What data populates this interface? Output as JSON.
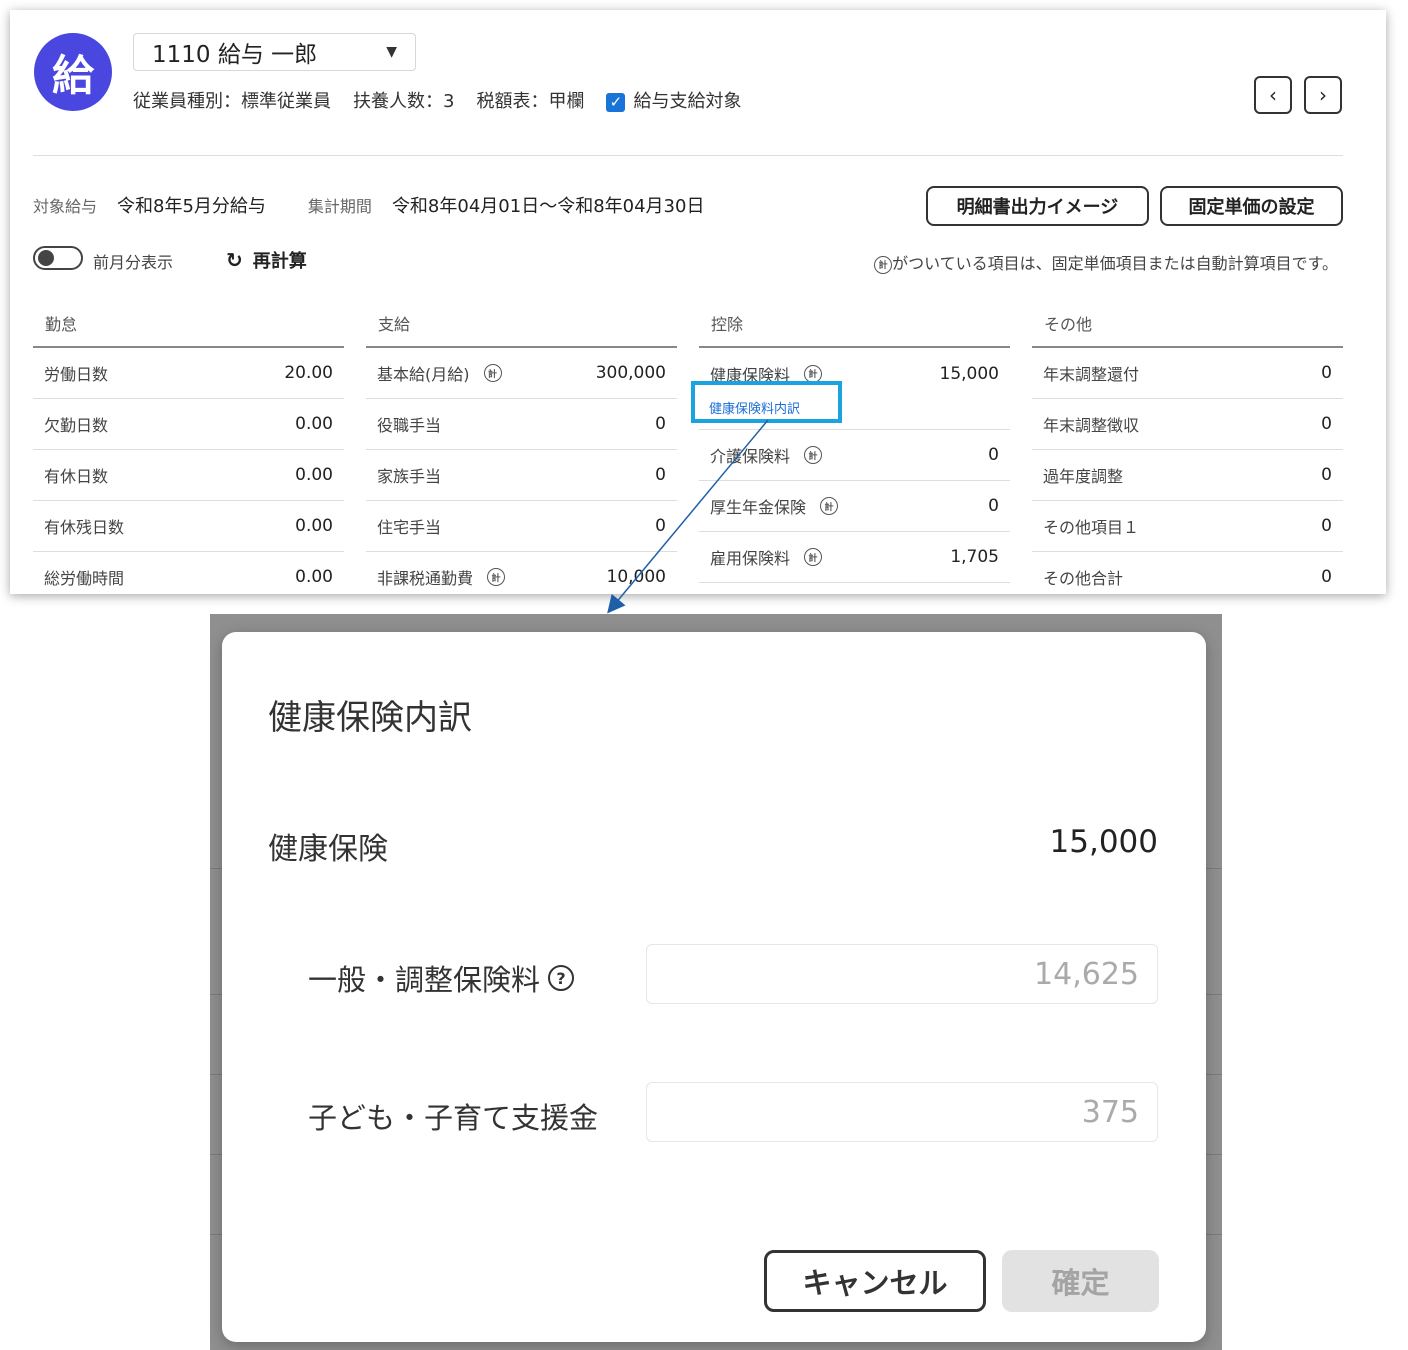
{
  "employee": {
    "avatar_char": "給",
    "selected": "1110 給与 一郎",
    "type": "従業員種別：標準従業員",
    "dependents": "扶養人数：3",
    "tax_table": "税額表：甲欄",
    "payroll_target_label": "給与支給対象",
    "payroll_target_checked": true
  },
  "period": {
    "target_label": "対象給与",
    "target_value": "令和8年5月分給与",
    "range_label": "集計期間",
    "range_value": "令和8年04月01日〜令和8年04月30日"
  },
  "actions": {
    "statement_preview": "明細書出力イメージ",
    "fixed_unit_price": "固定単価の設定",
    "show_prev_month": "前月分表示",
    "recalculate": "再計算",
    "note": "がついている項目は、固定単価項目または自動計算項目です。"
  },
  "columns": {
    "attendance": {
      "title": "勤怠",
      "rows": [
        {
          "name": "労働日数",
          "value": "20.00"
        },
        {
          "name": "欠勤日数",
          "value": "0.00"
        },
        {
          "name": "有休日数",
          "value": "0.00"
        },
        {
          "name": "有休残日数",
          "value": "0.00"
        },
        {
          "name": "総労働時間",
          "value": "0.00"
        }
      ]
    },
    "payment": {
      "title": "支給",
      "rows": [
        {
          "name": "基本給(月給)",
          "value": "300,000",
          "auto": true
        },
        {
          "name": "役職手当",
          "value": "0",
          "auto": false
        },
        {
          "name": "家族手当",
          "value": "0",
          "auto": false
        },
        {
          "name": "住宅手当",
          "value": "0",
          "auto": false
        },
        {
          "name": "非課税通勤費",
          "value": "10,000",
          "auto": true
        }
      ]
    },
    "deduction": {
      "title": "控除",
      "rows": [
        {
          "name": "健康保険料",
          "value": "15,000"
        },
        {
          "name": "介護保険料",
          "value": "0"
        },
        {
          "name": "厚生年金保険",
          "value": "0"
        },
        {
          "name": "雇用保険料",
          "value": "1,705"
        }
      ],
      "breakdown_link": "健康保険料内訳"
    },
    "other": {
      "title": "その他",
      "rows": [
        {
          "name": "年末調整還付",
          "value": "0"
        },
        {
          "name": "年末調整徴収",
          "value": "0"
        },
        {
          "name": "過年度調整",
          "value": "0"
        },
        {
          "name": "その他項目１",
          "value": "0"
        },
        {
          "name": "その他合計",
          "value": "0"
        }
      ]
    }
  },
  "modal": {
    "title": "健康保険内訳",
    "total_label": "健康保険",
    "total_value": "15,000",
    "general_label": "一般・調整保険料",
    "general_value": "14,625",
    "child_label": "子ども・子育て支援金",
    "child_value": "375",
    "cancel": "キャンセル",
    "confirm": "確定"
  },
  "icons": {
    "fx_glyph": "計",
    "help_glyph": "?"
  },
  "colors": {
    "avatar": "#4a46e0",
    "checkbox": "#1a73d8",
    "highlight": "#1aa3e0",
    "link": "#1a6fd8"
  }
}
